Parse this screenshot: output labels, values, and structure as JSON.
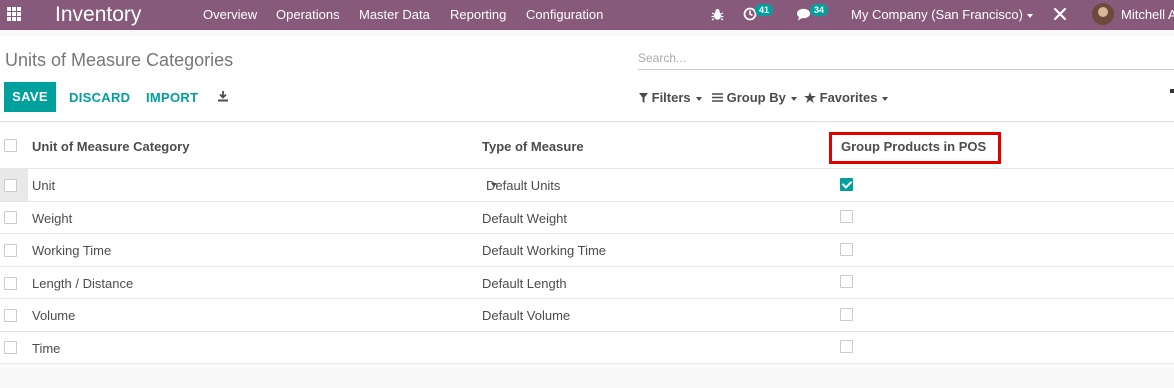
{
  "navbar": {
    "app_name": "Inventory",
    "menu": [
      "Overview",
      "Operations",
      "Master Data",
      "Reporting",
      "Configuration"
    ],
    "activity_count": "41",
    "message_count": "34",
    "company": "My Company (San Francisco)",
    "user": "Mitchell A",
    "color": "#875a7b"
  },
  "control": {
    "title": "Units of Measure Categories",
    "search_placeholder": "Search...",
    "save": "SAVE",
    "discard": "DISCARD",
    "import": "IMPORT",
    "filters": "Filters",
    "group_by": "Group By",
    "favorites": "Favorites",
    "accent": "#00a09d"
  },
  "table": {
    "columns": [
      "Unit of Measure Category",
      "Type of Measure",
      "Group Products in POS"
    ],
    "rows": [
      {
        "category": "Unit",
        "measure": "Default Units",
        "pos": true,
        "editing": true
      },
      {
        "category": "Weight",
        "measure": "Default Weight",
        "pos": false
      },
      {
        "category": "Working Time",
        "measure": "Default Working Time",
        "pos": false
      },
      {
        "category": "Length / Distance",
        "measure": "Default Length",
        "pos": false
      },
      {
        "category": "Volume",
        "measure": "Default Volume",
        "pos": false
      },
      {
        "category": "Time",
        "measure": "",
        "pos": false
      }
    ]
  }
}
